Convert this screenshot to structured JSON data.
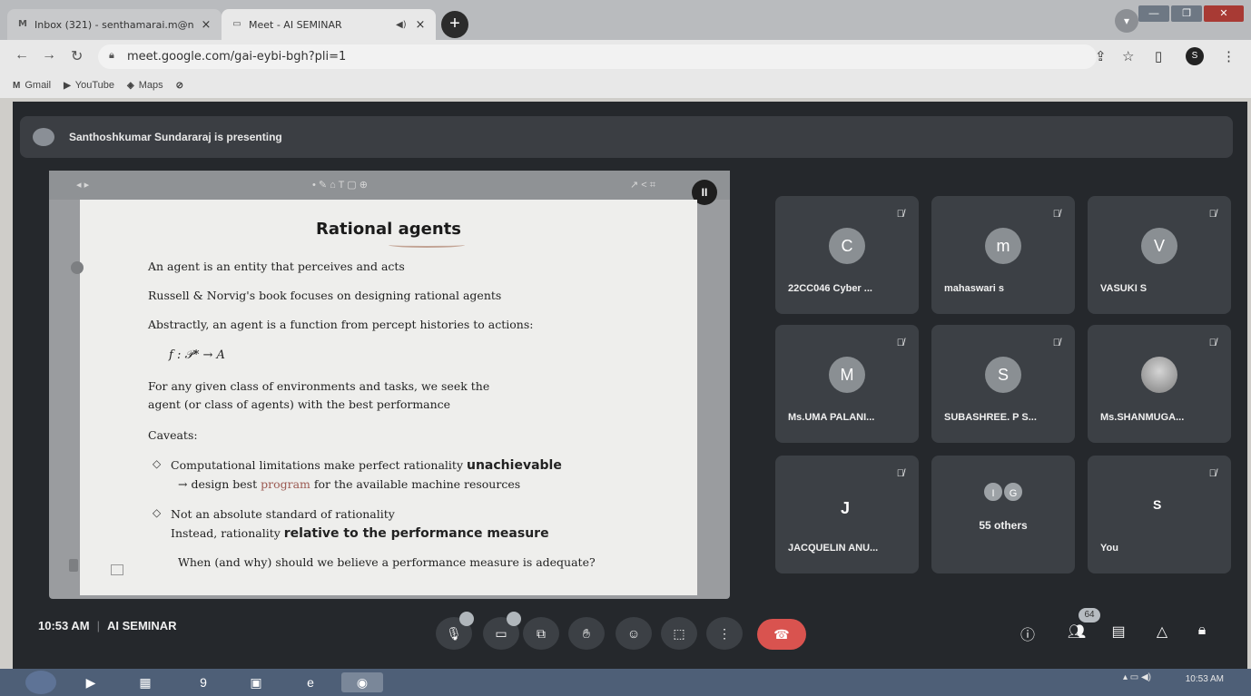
{
  "browser": {
    "tabs": [
      {
        "icon": "M",
        "title": "Inbox (321) - senthamarai.m@n",
        "close": "×"
      },
      {
        "icon": "▭",
        "title": "Meet - AI SEMINAR",
        "close": "×"
      }
    ],
    "new_tab": "+",
    "url": "meet.google.com/gai-eybi-bgh?pli=1",
    "profile_initial": "S",
    "bookmarks": [
      "Gmail",
      "YouTube",
      "Maps"
    ]
  },
  "meet": {
    "presenting_text": "Santhoshkumar Sundararaj is presenting",
    "time": "10:53 AM",
    "meeting_name": "AI SEMINAR",
    "participants_count": "64",
    "tiles": [
      {
        "initial": "C",
        "name": "22CC046 Cyber ...",
        "muted": true,
        "avatar_color": "#8a8f93"
      },
      {
        "initial": "m",
        "name": "mahaswari s",
        "muted": true,
        "avatar_color": "#8a8f93"
      },
      {
        "initial": "V",
        "name": "VASUKI S",
        "muted": true,
        "avatar_color": "#8a8f93"
      },
      {
        "initial": "M",
        "name": "Ms.UMA PALANI...",
        "muted": true,
        "avatar_color": "#8a8f93"
      },
      {
        "initial": "S",
        "name": "SUBASHREE. P S...",
        "muted": true,
        "avatar_color": "#8a8f93"
      },
      {
        "initial": "",
        "name": "Ms.SHANMUGA...",
        "muted": true,
        "avatar_color": "photo"
      },
      {
        "initial": "J",
        "name": "JACQUELIN ANU...",
        "muted": true,
        "avatar_color": "none"
      },
      {
        "initial": "",
        "name": "55 others",
        "muted": false,
        "stack": [
          "I",
          "G"
        ]
      },
      {
        "initial": "S",
        "name": "You",
        "muted": true,
        "avatar_color": "none"
      }
    ]
  },
  "slide": {
    "title": "Rational agents",
    "lines": {
      "l1": "An agent is an entity that perceives and acts",
      "l2": "Russell & Norvig's book focuses on designing rational agents",
      "l3": "Abstractly, an agent is a function from percept histories to actions:",
      "formula": "f : 𝒫* → A",
      "l4a": "For any given class of environments and tasks, we seek the",
      "l4b": "agent (or class of agents) with the best performance",
      "caveats": "Caveats:",
      "b1a": "Computational limitations make perfect rationality",
      "b1a_big": "unachievable",
      "b1b": "→ design best",
      "b1b_red": "program",
      "b1b_end": "for the available machine resources",
      "b2a": "Not an absolute standard of rationality",
      "b2b": "Instead, rationality",
      "b2b_big": "relative to the performance measure",
      "b3": "When (and why) should we believe a performance measure is adequate?"
    }
  },
  "taskbar": {
    "clock_time": "10:53 AM"
  }
}
